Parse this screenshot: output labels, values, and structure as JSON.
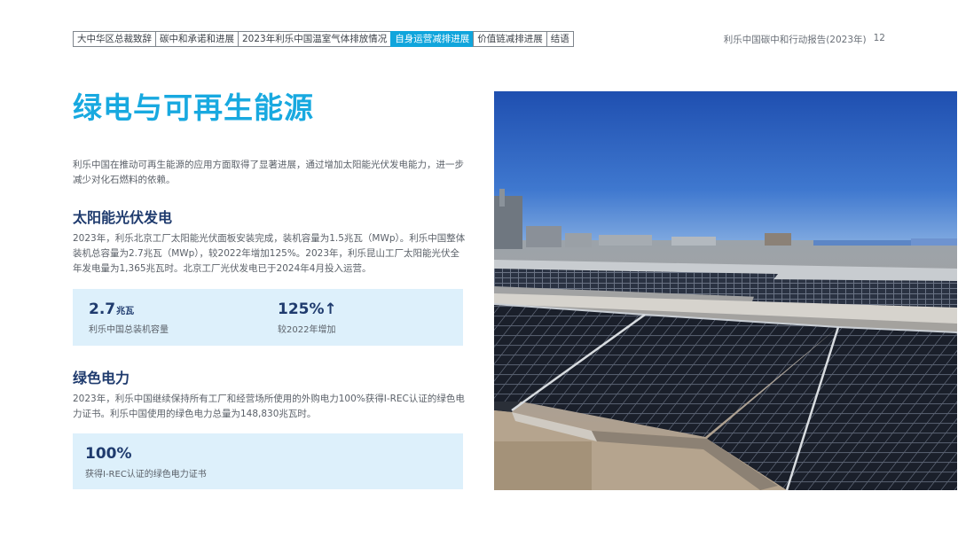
{
  "nav": {
    "tabs": [
      {
        "label": "大中华区总裁致辞",
        "active": false
      },
      {
        "label": "碳中和承诺和进展",
        "active": false
      },
      {
        "label": "2023年利乐中国温室气体排放情况",
        "active": false
      },
      {
        "label": "自身运营减排进展",
        "active": true
      },
      {
        "label": "价值链减排进展",
        "active": false
      },
      {
        "label": "结语",
        "active": false
      }
    ]
  },
  "header": {
    "report_title": "利乐中国碳中和行动报告(2023年)",
    "page_number": "12"
  },
  "page_title": "绿电与可再生能源",
  "intro": "利乐中国在推动可再生能源的应用方面取得了显著进展，通过增加太阳能光伏发电能力，进一步减少对化石燃料的依赖。",
  "solar": {
    "heading": "太阳能光伏发电",
    "body": "2023年，利乐北京工厂太阳能光伏面板安装完成，装机容量为1.5兆瓦（MWp）。利乐中国整体装机总容量为2.7兆瓦（MWp），较2022年增加125%。2023年，利乐昆山工厂太阳能光伏全年发电量为1,365兆瓦时。北京工厂光伏发电已于2024年4月投入运营。",
    "stat1": {
      "value": "2.7",
      "unit": "兆瓦",
      "label": "利乐中国总装机容量"
    },
    "stat2": {
      "value": "125%↑",
      "label": "较2022年增加"
    }
  },
  "green": {
    "heading": "绿色电力",
    "body": "2023年，利乐中国继续保持所有工厂和经营场所使用的外购电力100%获得I-REC认证的绿色电力证书。利乐中国使用的绿色电力总量为148,830兆瓦时。",
    "stat1": {
      "value": "100%",
      "label": "获得I-REC认证的绿色电力证书"
    }
  },
  "colors": {
    "accent": "#18a9e0",
    "heading": "#1f3b6e",
    "stat_box": "#ddf0fb",
    "active_tab": "#10a5dc"
  }
}
